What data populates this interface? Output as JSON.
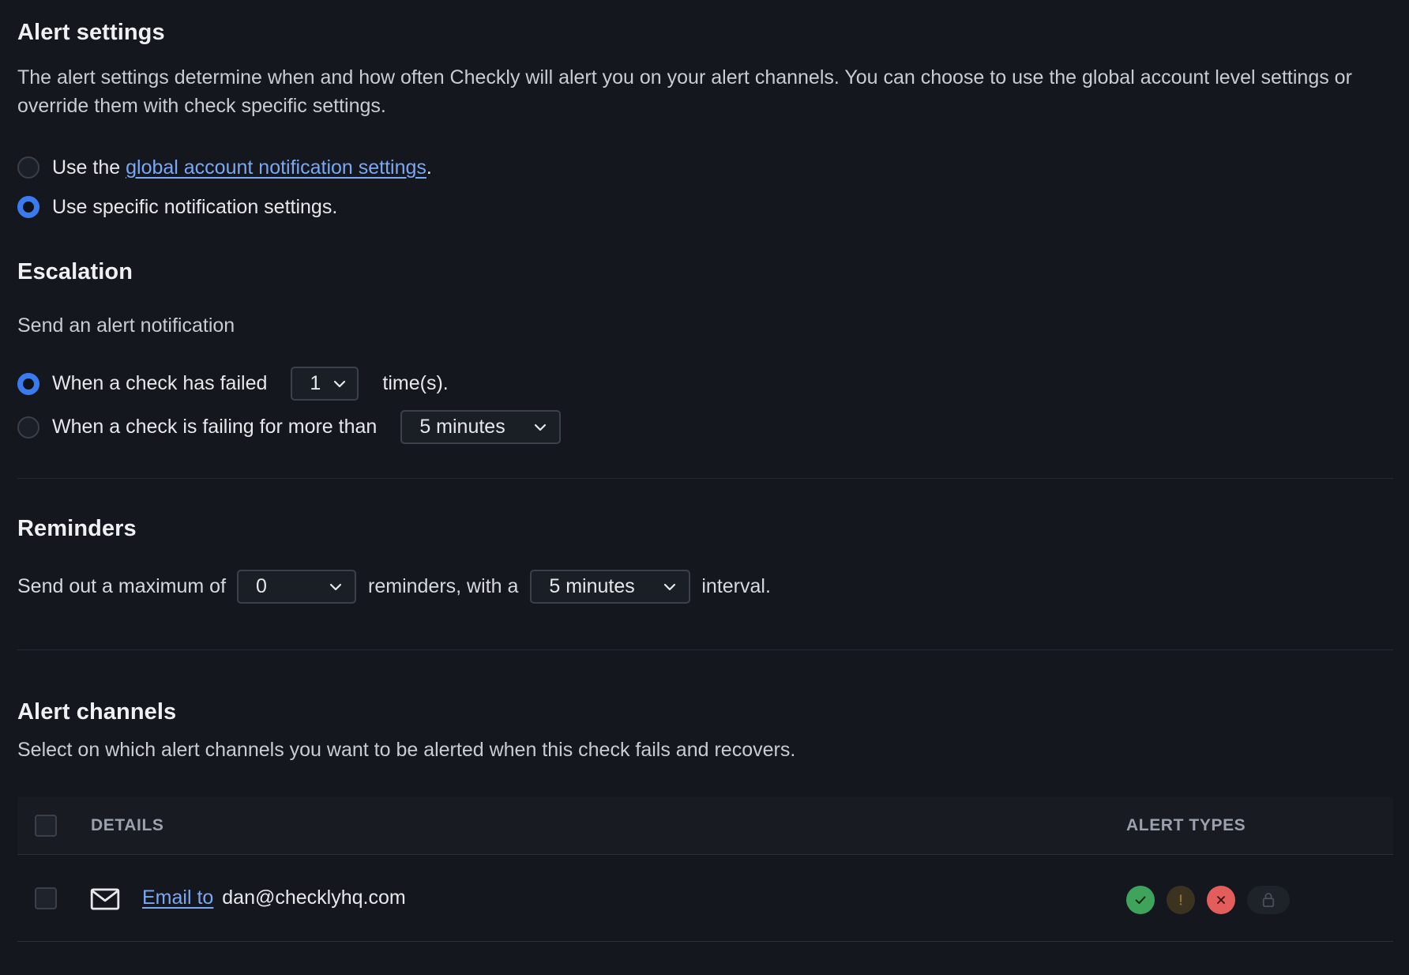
{
  "alert_settings": {
    "title": "Alert settings",
    "description": "The alert settings determine when and how often Checkly will alert you on your alert channels. You can choose to use the global account level settings or override them with check specific settings.",
    "option_global_prefix": "Use the ",
    "option_global_link": "global account notification settings",
    "option_global_suffix": ".",
    "option_specific": "Use specific notification settings.",
    "selected": "specific"
  },
  "escalation": {
    "title": "Escalation",
    "subtitle": "Send an alert notification",
    "option_failed_label": "When a check has failed",
    "failed_count": "1",
    "failed_suffix": "time(s).",
    "option_failing_label": "When a check is failing for more than",
    "failing_duration": "5 minutes",
    "selected": "failed"
  },
  "reminders": {
    "title": "Reminders",
    "prefix": "Send out a maximum of",
    "max_count": "0",
    "middle": "reminders, with a",
    "interval": "5 minutes",
    "suffix": "interval."
  },
  "alert_channels": {
    "title": "Alert channels",
    "description": "Select on which alert channels you want to be alerted when this check fails and recovers.",
    "columns": [
      "DETAILS",
      "ALERT TYPES"
    ],
    "rows": [
      {
        "icon": "envelope-icon",
        "link": "Email to",
        "target": "dan@checklyhq.com",
        "alert_types": [
          "recovery-check-icon",
          "degraded-exclamation-icon",
          "failure-x-icon",
          "ssl-lock-icon"
        ]
      }
    ]
  },
  "colors": {
    "background": "#14171d",
    "accent_blue": "#3a7bf0",
    "link": "#7aa8f5",
    "success": "#3fa45b",
    "warning_bg": "#3b3220",
    "error": "#e45d5d"
  }
}
